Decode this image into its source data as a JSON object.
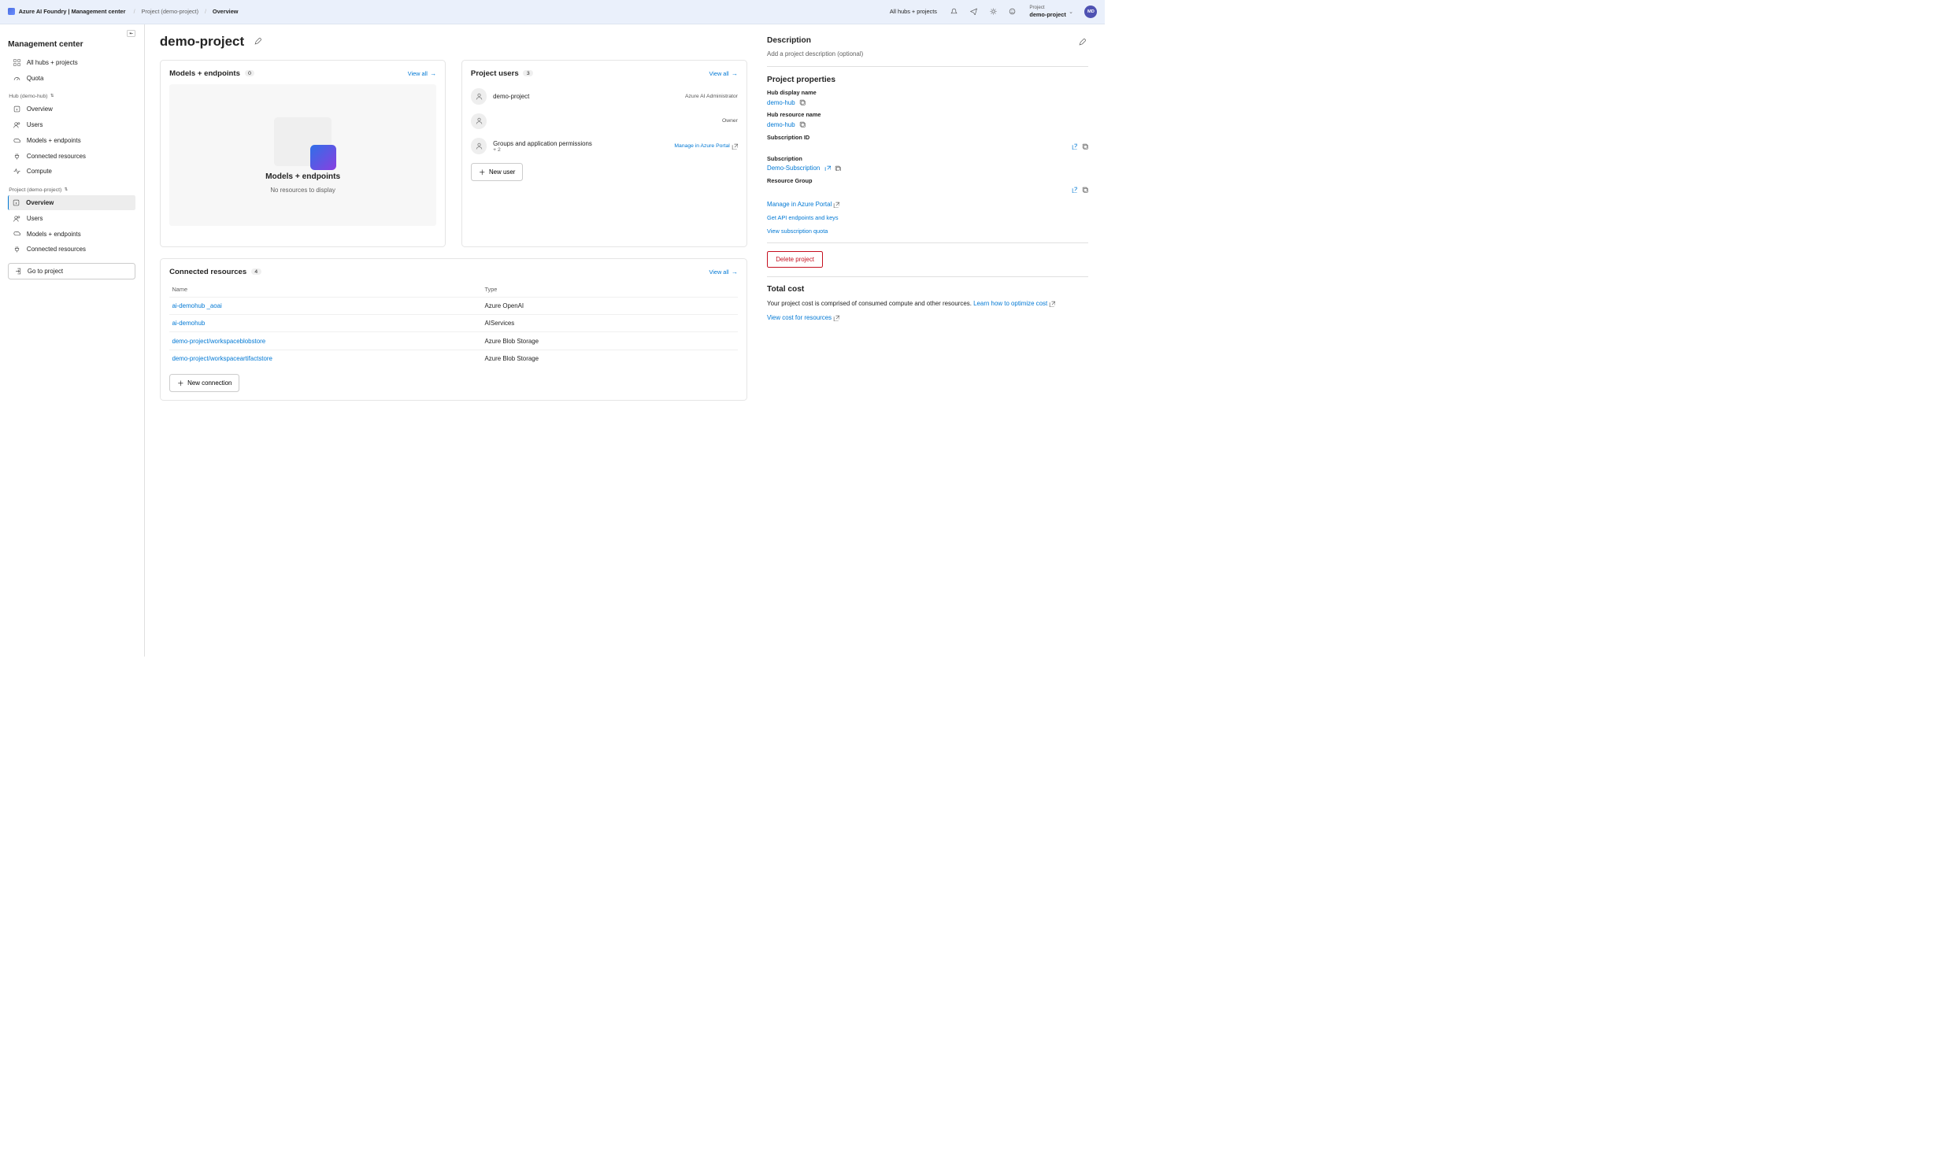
{
  "header": {
    "brand": "Azure AI Foundry | Management center",
    "breadcrumb": [
      "Project (demo-project)",
      "Overview"
    ],
    "scope": "All hubs + projects",
    "project_switcher": {
      "label": "Project",
      "value": "demo-project"
    },
    "avatar_initials": "MD"
  },
  "sidebar": {
    "title": "Management center",
    "top_items": [
      {
        "id": "all-hubs",
        "label": "All hubs + projects",
        "icon": "grid"
      },
      {
        "id": "quota",
        "label": "Quota",
        "icon": "gauge"
      }
    ],
    "hub_group": {
      "label": "Hub (demo-hub)",
      "items": [
        {
          "id": "hub-overview",
          "label": "Overview",
          "icon": "info"
        },
        {
          "id": "hub-users",
          "label": "Users",
          "icon": "users"
        },
        {
          "id": "hub-models",
          "label": "Models + endpoints",
          "icon": "cloud"
        },
        {
          "id": "hub-conn",
          "label": "Connected resources",
          "icon": "plug"
        },
        {
          "id": "hub-compute",
          "label": "Compute",
          "icon": "activity"
        }
      ]
    },
    "project_group": {
      "label": "Project (demo-project)",
      "items": [
        {
          "id": "proj-overview",
          "label": "Overview",
          "icon": "info",
          "selected": true
        },
        {
          "id": "proj-users",
          "label": "Users",
          "icon": "users"
        },
        {
          "id": "proj-models",
          "label": "Models + endpoints",
          "icon": "cloud"
        },
        {
          "id": "proj-conn",
          "label": "Connected resources",
          "icon": "plug"
        }
      ]
    },
    "go_to_project": "Go to project"
  },
  "page": {
    "title": "demo-project"
  },
  "models_card": {
    "title": "Models + endpoints",
    "count": "0",
    "view_all": "View all",
    "empty_title": "Models + endpoints",
    "empty_sub": "No resources to display"
  },
  "users_card": {
    "title": "Project users",
    "count": "3",
    "view_all": "View all",
    "items": [
      {
        "name": "demo-project",
        "role": "Azure AI Administrator"
      },
      {
        "name": "",
        "role": "Owner"
      },
      {
        "name": "Groups and application permissions",
        "sub": "+ 2",
        "role_link": "Manage in Azure Portal"
      }
    ],
    "new_user": "New user"
  },
  "connected_card": {
    "title": "Connected resources",
    "count": "4",
    "view_all": "View all",
    "columns": [
      "Name",
      "Type"
    ],
    "rows": [
      {
        "name": "ai-demohub            _aoai",
        "type": "Azure OpenAI"
      },
      {
        "name": "ai-demohub",
        "type": "AIServices"
      },
      {
        "name": "demo-project/workspaceblobstore",
        "type": "Azure Blob Storage"
      },
      {
        "name": "demo-project/workspaceartifactstore",
        "type": "Azure Blob Storage"
      }
    ],
    "new_connection": "New connection"
  },
  "right": {
    "description_title": "Description",
    "description_placeholder": "Add a project description (optional)",
    "properties_title": "Project properties",
    "props": {
      "hub_display_label": "Hub display name",
      "hub_display_value": "demo-hub",
      "hub_resource_label": "Hub resource name",
      "hub_resource_value": "demo-hub",
      "subscription_id_label": "Subscription ID",
      "subscription_label": "Subscription",
      "subscription_value": "Demo-Subscription",
      "resource_group_label": "Resource Group"
    },
    "actions": {
      "manage_portal": "Manage in Azure Portal",
      "get_endpoints": "Get API endpoints and keys",
      "view_quota": "View subscription quota"
    },
    "delete": "Delete project",
    "cost_title": "Total cost",
    "cost_text": "Your project cost is comprised of consumed compute and other resources. ",
    "cost_learn": "Learn how to optimize cost",
    "cost_view": "View cost for resources"
  }
}
